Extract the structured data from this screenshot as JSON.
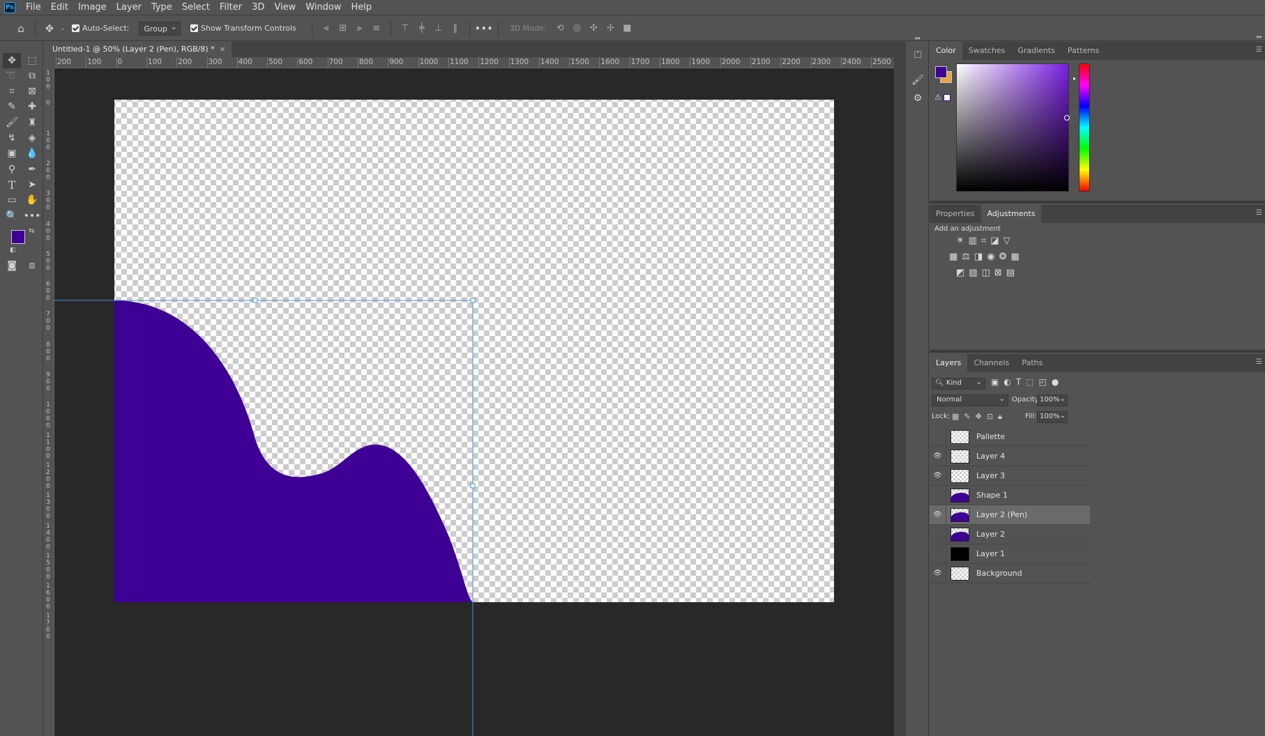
{
  "app": {
    "logo_text": "Ps"
  },
  "menu": [
    "File",
    "Edit",
    "Image",
    "Layer",
    "Type",
    "Select",
    "Filter",
    "3D",
    "View",
    "Window",
    "Help"
  ],
  "options_bar": {
    "auto_select_label": "Auto-Select:",
    "auto_select_value": "Group",
    "show_transform_label": "Show Transform Controls",
    "mode_3d_label": "3D Mode:"
  },
  "document": {
    "tab_title": "Untitled-1 @ 50% (Layer 2 (Pen), RGB/8) *",
    "close_glyph": "×"
  },
  "rulers": {
    "top_labels": [
      "200",
      "100",
      "0",
      "100",
      "200",
      "300",
      "400",
      "500",
      "600",
      "700",
      "800",
      "900",
      "1000",
      "1100",
      "1200",
      "1300",
      "1400",
      "1500",
      "1600",
      "1700",
      "1800",
      "1900",
      "2000",
      "2100",
      "2200",
      "2300",
      "2400",
      "2500"
    ],
    "left_labels": [
      "100",
      "0",
      "100",
      "200",
      "300",
      "400",
      "500",
      "600",
      "700",
      "800",
      "900",
      "1000",
      "1100",
      "1200",
      "1300",
      "1400",
      "1500",
      "1600",
      "1700"
    ]
  },
  "colors": {
    "foreground": "#3e0094",
    "background": "#e8a33c",
    "shape_fill": "#3e0094",
    "selection": "#4a90d9"
  },
  "color_panel": {
    "tabs": [
      "Color",
      "Swatches",
      "Gradients",
      "Patterns"
    ],
    "active_tab": "Color"
  },
  "adjustments_panel": {
    "tabs": [
      "Properties",
      "Adjustments"
    ],
    "active_tab": "Adjustments",
    "hint": "Add an adjustment"
  },
  "layers_panel": {
    "tabs": [
      "Layers",
      "Channels",
      "Paths"
    ],
    "active_tab": "Layers",
    "filter_label": "Kind",
    "blend_mode": "Normal",
    "opacity_label": "Opacity:",
    "opacity_value": "100%",
    "lock_label": "Lock:",
    "fill_label": "Fill:",
    "fill_value": "100%",
    "layers": [
      {
        "name": "Pallette",
        "visible": false,
        "thumb": "transparent"
      },
      {
        "name": "Layer 4",
        "visible": true,
        "thumb": "transparent"
      },
      {
        "name": "Layer 3",
        "visible": true,
        "thumb": "transparent"
      },
      {
        "name": "Shape 1",
        "visible": false,
        "thumb": "purple"
      },
      {
        "name": "Layer 2 (Pen)",
        "visible": true,
        "thumb": "purple",
        "selected": true
      },
      {
        "name": "Layer 2",
        "visible": false,
        "thumb": "purple"
      },
      {
        "name": "Layer 1",
        "visible": false,
        "thumb": "black"
      },
      {
        "name": "Background",
        "visible": true,
        "thumb": "transparent"
      }
    ]
  }
}
